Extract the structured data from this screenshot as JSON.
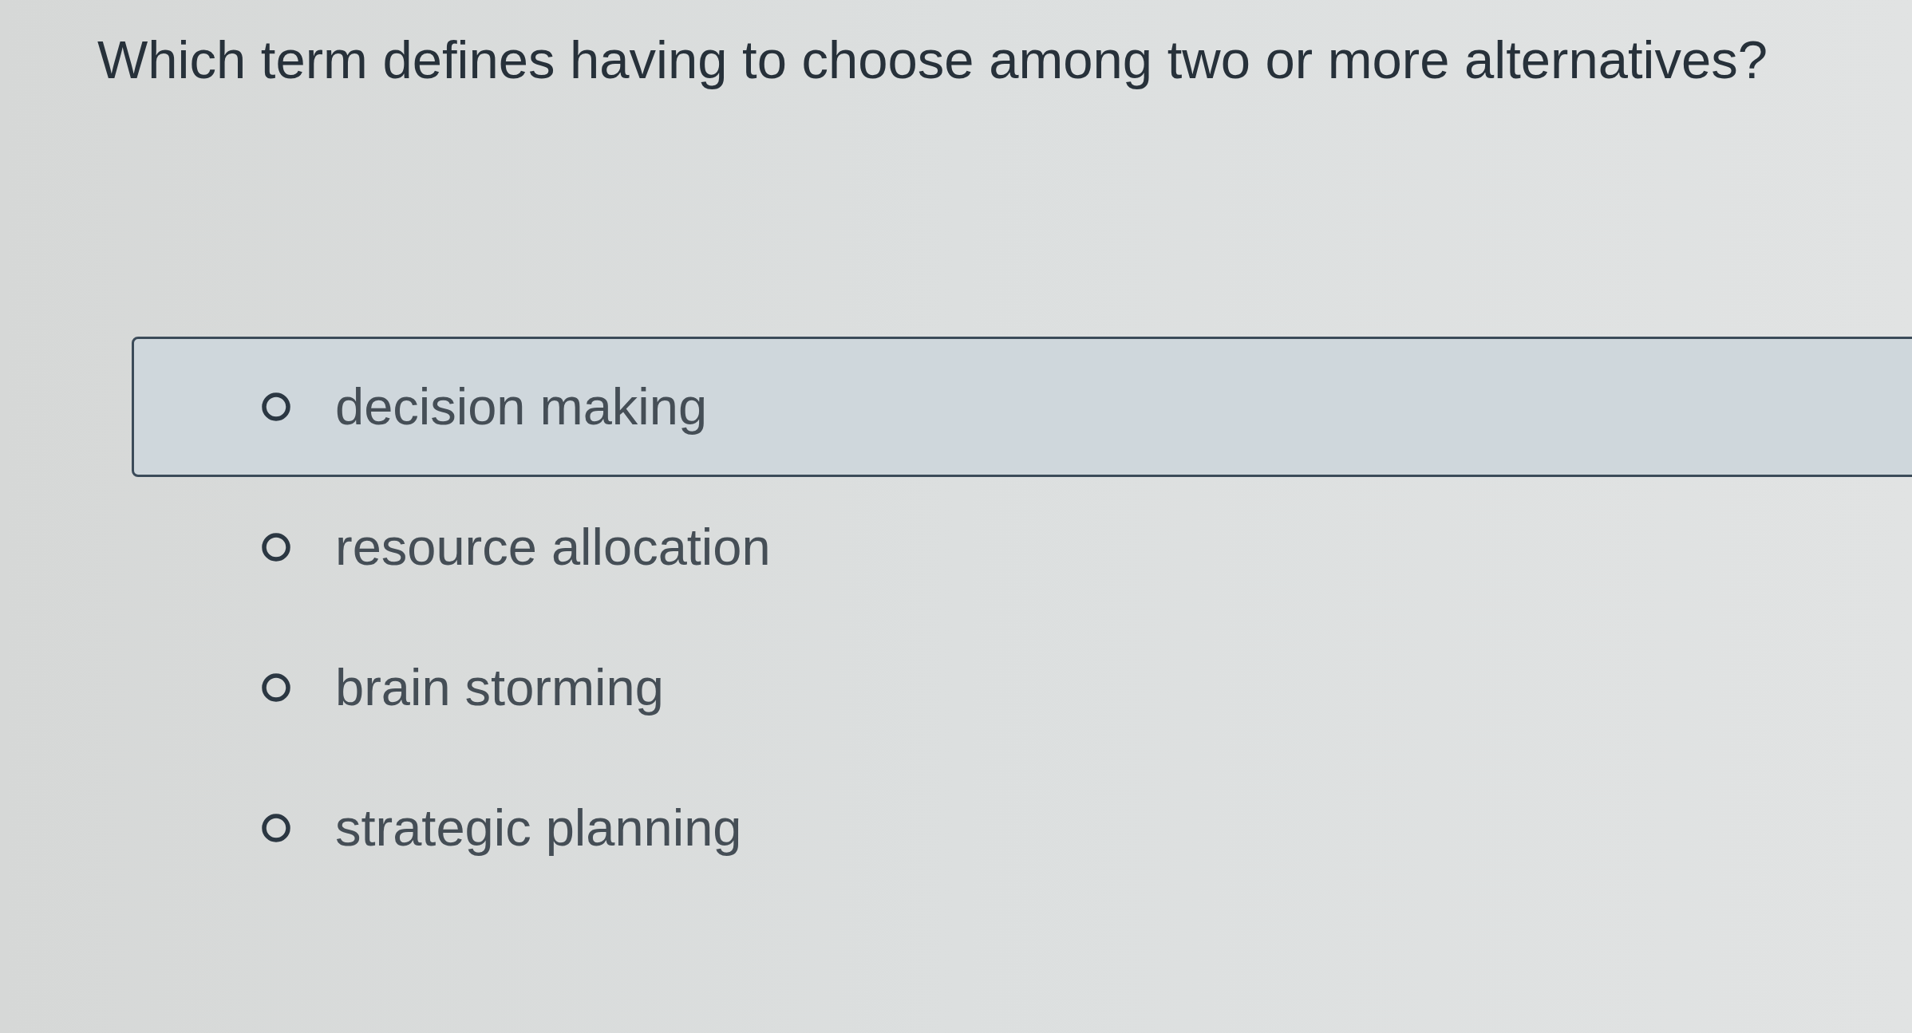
{
  "question": {
    "text": "Which term defines having to choose among two or more alternatives?"
  },
  "options": [
    {
      "label": "decision making",
      "selected": false,
      "highlighted": true
    },
    {
      "label": "resource allocation",
      "selected": false,
      "highlighted": false
    },
    {
      "label": "brain storming",
      "selected": false,
      "highlighted": false
    },
    {
      "label": "strategic planning",
      "selected": false,
      "highlighted": false
    }
  ]
}
